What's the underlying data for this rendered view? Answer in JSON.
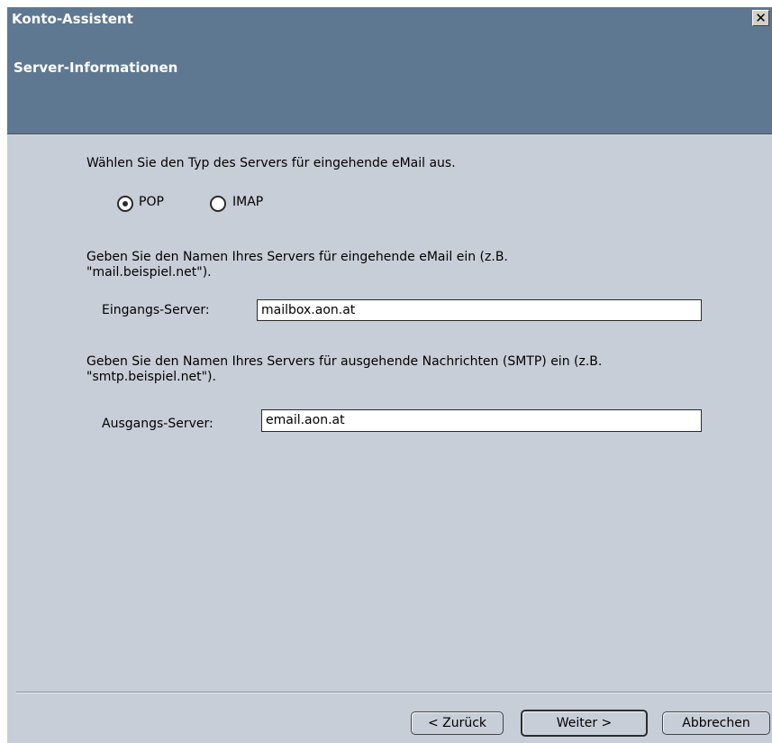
{
  "window": {
    "title": "Konto-Assistent",
    "close_glyph": "✕"
  },
  "header": {
    "title": "Server-Informationen"
  },
  "server_type": {
    "prompt": "Wählen Sie den Typ des Servers für eingehende eMail aus.",
    "options": [
      {
        "label": "POP",
        "selected": true
      },
      {
        "label": "IMAP",
        "selected": false
      }
    ]
  },
  "incoming": {
    "description_line1": "Geben Sie den Namen Ihres Servers für eingehende eMail ein (z.B.",
    "description_line2": "\"mail.beispiel.net\").",
    "label": "Eingangs-Server:",
    "value": "mailbox.aon.at"
  },
  "outgoing": {
    "description_line1": "Geben Sie den Namen Ihres Servers für ausgehende Nachrichten (SMTP) ein (z.B.",
    "description_line2": "\"smtp.beispiel.net\").",
    "label": "Ausgangs-Server:",
    "value": "email.aon.at"
  },
  "buttons": {
    "back": "< Zurück",
    "next": "Weiter >",
    "cancel": "Abbrechen"
  }
}
